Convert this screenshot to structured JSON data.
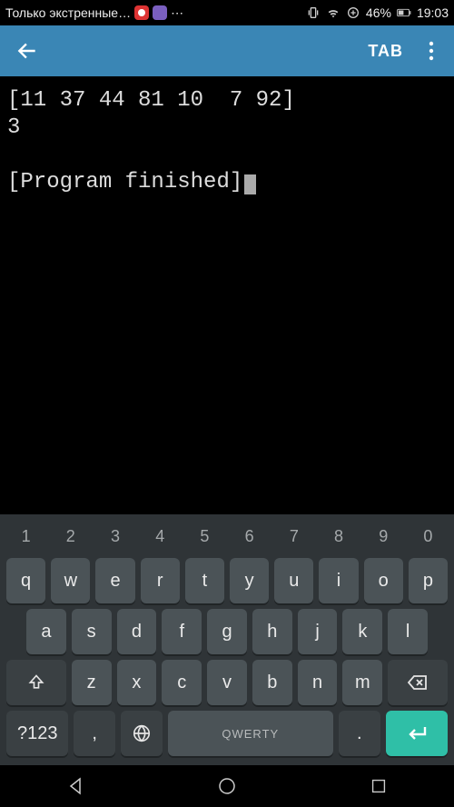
{
  "status": {
    "carrier": "Только экстренные…",
    "battery_percent": "46%",
    "time": "19:03"
  },
  "appbar": {
    "tab_label": "TAB"
  },
  "terminal": {
    "line1": "[11 37 44 81 10  7 92]",
    "line2": "3",
    "line3": "",
    "line4": "[Program finished]"
  },
  "keyboard": {
    "row_num": [
      "1",
      "2",
      "3",
      "4",
      "5",
      "6",
      "7",
      "8",
      "9",
      "0"
    ],
    "row1": [
      "q",
      "w",
      "e",
      "r",
      "t",
      "y",
      "u",
      "i",
      "o",
      "p"
    ],
    "row2": [
      "a",
      "s",
      "d",
      "f",
      "g",
      "h",
      "j",
      "k",
      "l"
    ],
    "row3": [
      "z",
      "x",
      "c",
      "v",
      "b",
      "n",
      "m"
    ],
    "sym_key": "?123",
    "comma": ",",
    "space_label": "QWERTY",
    "period": "."
  }
}
